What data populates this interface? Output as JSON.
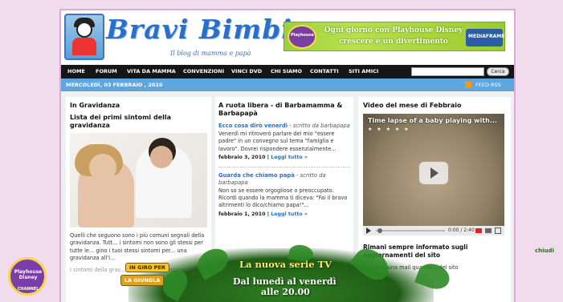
{
  "header": {
    "logo_title": "Bravi Bimbi",
    "logo_subtitle": "Il blog di mamma e papà",
    "banner_line1": "Ogni giorno con Playhouse Disney",
    "banner_line2": "crescere è un divertimento",
    "banner_badge": "Playhouse",
    "banner_channel": "MEDIAFRAME"
  },
  "nav": {
    "items": [
      "HOME",
      "FORUM",
      "VITA DA MAMMA",
      "CONVENZIONI",
      "VINCI DVD",
      "CHI SIAMO",
      "CONTATTI",
      "SITI AMICI"
    ],
    "search_value": "",
    "search_button": "Cerca"
  },
  "datebar": {
    "date": "MERCOLEDÌ, 03 FEBBRAIO , 2010",
    "feed": "FEED RSS"
  },
  "col1": {
    "section": "In Gravidanza",
    "title": "Lista dei primi sintomi della gravidanza",
    "text1": "Quelli che seguono sono i più comuni segnali della gravidanza. Tutt... i sintomi non sono gli stessi per tutte le... gino i tuoi stessi sintomi per... una gravidanza all'i...",
    "text2": "I sintomi della grav... intensità, frequenza e..."
  },
  "col2": {
    "section": "A ruota libera - di Barbamamma & Barbapapà",
    "posts": [
      {
        "title": "Ecco cosa dirò venerdì",
        "by": " - scritto da barbapapa",
        "text": "Venerdì mi ritroverò  parlare del mio \"essere padre\" in un convegno sul tema \"famiglia e lavoro\". Dovrei rispondere essenzialmente...",
        "date": "febbraio 3, 2010 |",
        "more": "Leggi tutto »"
      },
      {
        "title": "Guarda che chiamo papà",
        "by": " - scritto da barbapapa",
        "text": "Non so se essere orgogliose o preoccupato. Ricordi quando la mamma ti diceva: \"Fai il bravo altrimenti lo dico/chiamo papa!\"...",
        "date": "febbraio 1, 2010 |",
        "more": "Leggi tutto »"
      }
    ]
  },
  "col3": {
    "section": "Video del mese di Febbraio",
    "video_title": "Time lapse of a baby playing with...",
    "video_stars": "★ ★ ★ ★ ★",
    "video_time": "0:00 / 2:40",
    "side_title": "Rimani sempre informato sugli aggiornamenti del sito",
    "side_text": "...cevere una mail quando ...del sito"
  },
  "overlay": {
    "title": "La nuova serie TV",
    "line1": "Dal lunedì al venerdì",
    "line2": "alle 20.00",
    "show_a": "IN GIRO PER",
    "show_b": "LA GIUNGLA",
    "channel_line": "Playhouse Disney",
    "channel_word": "CHANNEL",
    "close": "chiudi"
  }
}
